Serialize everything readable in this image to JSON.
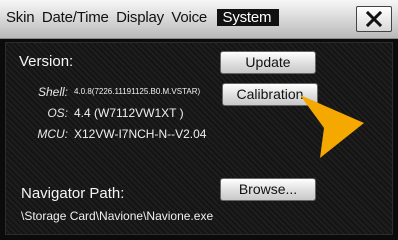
{
  "header": {
    "tabs": [
      {
        "label": "Skin"
      },
      {
        "label": "Date/Time"
      },
      {
        "label": "Display"
      },
      {
        "label": "Voice"
      },
      {
        "label": "System"
      }
    ],
    "active_tab": "System",
    "close_icon": "close-icon"
  },
  "system": {
    "version_label": "Version:",
    "shell_key": "Shell:",
    "shell_value": "4.0.8(7226.11191125.B0.M.VSTAR)",
    "os_key": "OS:",
    "os_value": "4.4 (W7112VW1XT  )",
    "mcu_key": "MCU:",
    "mcu_value": "X12VW-I7NCH-N--V2.04",
    "update_label": "Update",
    "calibration_label": "Calibration",
    "navigator_label": "Navigator Path:",
    "browse_label": "Browse...",
    "navigator_path": "\\Storage Card\\Navione\\Navione.exe"
  },
  "overlay": {
    "pointer_icon": "cursor-arrow-icon",
    "pointer_color": "#f5a800"
  },
  "colors": {
    "header_bg": "#d8d8d8",
    "panel_bg": "#161616",
    "button_bg": "#f0f0f0"
  }
}
